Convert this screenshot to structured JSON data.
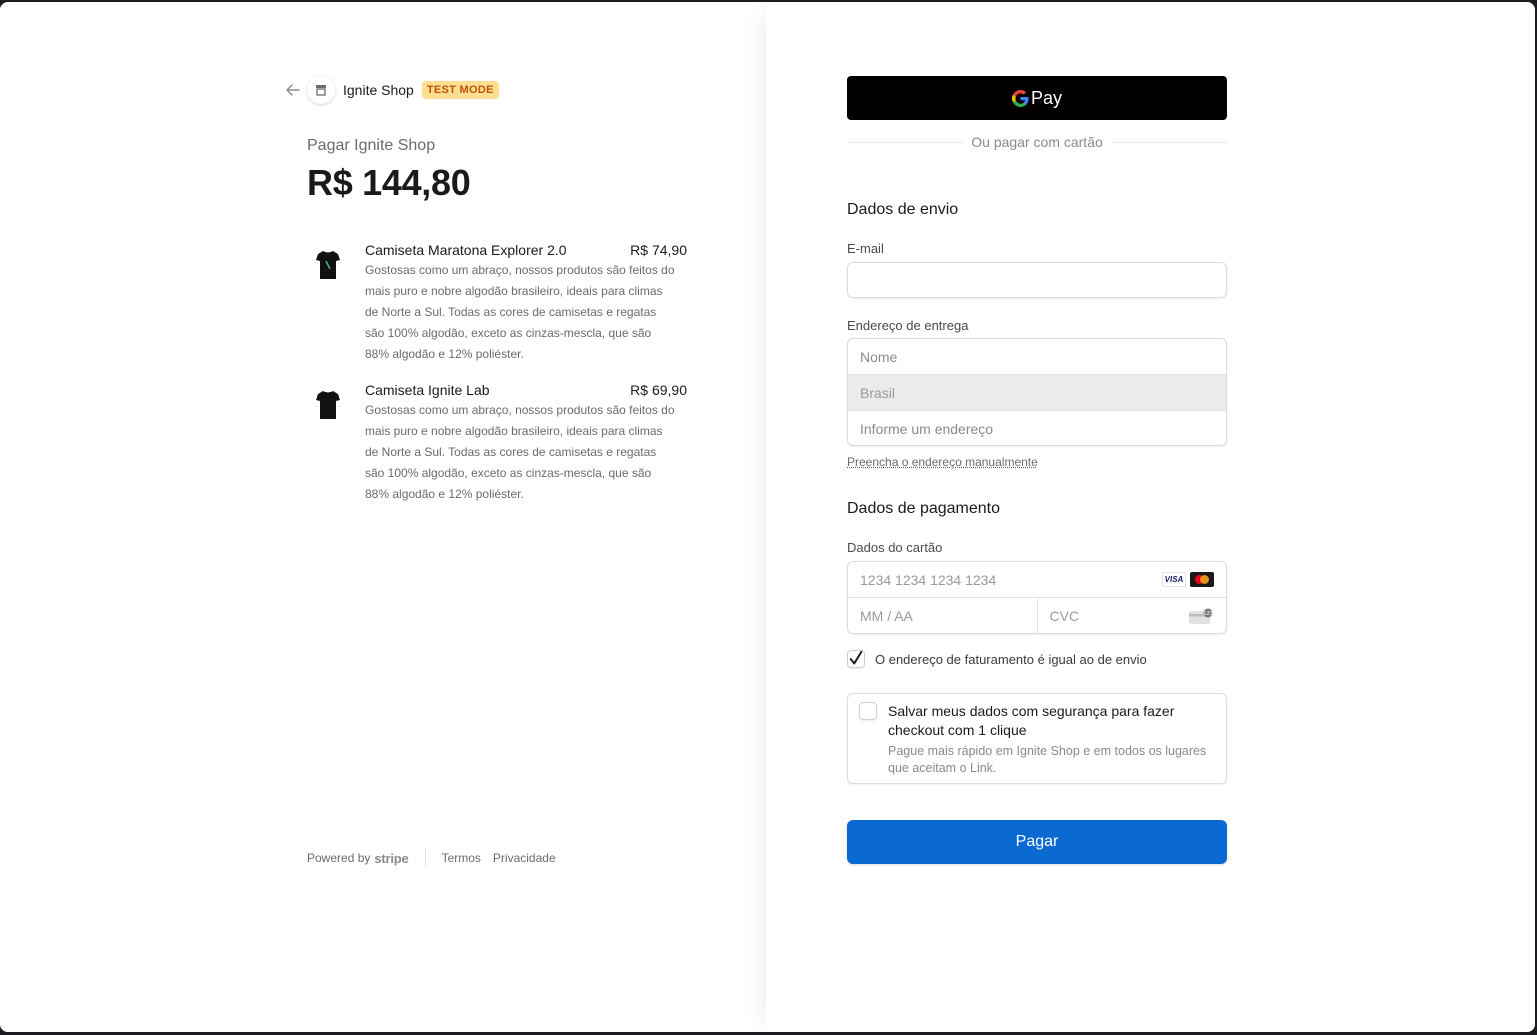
{
  "shop": {
    "name": "Ignite Shop",
    "test_badge": "TEST MODE",
    "pay_title": "Pagar Ignite Shop",
    "total": "R$ 144,80"
  },
  "items": [
    {
      "name": "Camiseta Maratona Explorer 2.0",
      "price": "R$ 74,90",
      "description": "Gostosas como um abraço, nossos produtos são feitos do mais puro e nobre algodão brasileiro, ideais para climas de Norte a Sul. Todas as cores de camisetas e regatas são 100% algodão, exceto as cinzas-mescla, que são 88% algodão e 12% poliéster."
    },
    {
      "name": "Camiseta Ignite Lab",
      "price": "R$ 69,90",
      "description": "Gostosas como um abraço, nossos produtos são feitos do mais puro e nobre algodão brasileiro, ideais para climas de Norte a Sul. Todas as cores de camisetas e regatas são 100% algodão, exceto as cinzas-mescla, que são 88% algodão e 12% poliéster."
    }
  ],
  "footer": {
    "powered_by": "Powered by",
    "stripe": "stripe",
    "terms": "Termos",
    "privacy": "Privacidade"
  },
  "checkout": {
    "gpay_label": "Pay",
    "or_pay_card": "Ou pagar com cartão",
    "shipping_title": "Dados de envio",
    "email_label": "E-mail",
    "email_value": "",
    "address_label": "Endereço de entrega",
    "name_placeholder": "Nome",
    "country": "Brasil",
    "address_placeholder": "Informe um endereço",
    "manual_address": "Preencha o endereço manualmente",
    "payment_title": "Dados de pagamento",
    "card_label": "Dados do cartão",
    "card_number_placeholder": "1234 1234 1234 1234",
    "card_brands": [
      "VISA",
      "mastercard"
    ],
    "expiry_placeholder": "MM / AA",
    "cvc_placeholder": "CVC",
    "billing_same_label": "O endereço de faturamento é igual ao de envio",
    "billing_same_checked": true,
    "save_title": "Salvar meus dados com segurança para fazer checkout com 1 clique",
    "save_desc": "Pague mais rápido em Ignite Shop e em todos os lugares que aceitam o Link.",
    "save_checked": false,
    "pay_button": "Pagar"
  },
  "colors": {
    "pay_button": "#0a6ad2",
    "test_badge_bg": "#ffde92",
    "test_badge_text": "#bb5504",
    "gpay_bg": "#000000"
  }
}
